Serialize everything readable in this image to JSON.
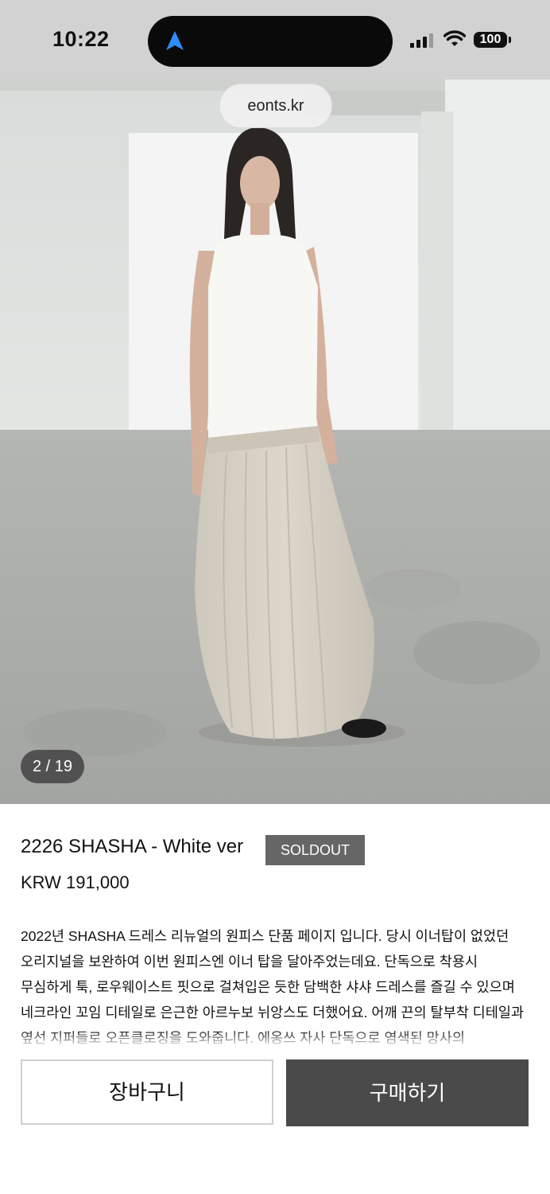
{
  "status_bar": {
    "time": "10:22",
    "battery": "100",
    "icons": [
      "navigation-arrow-icon",
      "signal-icon",
      "wifi-icon",
      "battery-icon"
    ]
  },
  "browser": {
    "url": "eonts.kr"
  },
  "gallery": {
    "counter": "2 / 19"
  },
  "product": {
    "title": "2226 SHASHA - White ver",
    "badge": "SOLDOUT",
    "price": "KRW 191,000",
    "description": "2022년 SHASHA 드레스 리뉴얼의 원피스 단품 페이지 입니다. 당시 이너탑이 없었던 오리지널을 보완하여 이번 원피스엔 이너 탑을 달아주었는데요. 단독으로 착용시 무심하게 툭, 로우웨이스트 핏으로 걸쳐입은 듯한 담백한 샤샤 드레스를 즐길 수 있으며 네크라인 꼬임 디테일로 은근한 아르누보 뉘앙스도 더했어요. 어깨 끈의 탈부착 디테일과 옆선 지퍼들로 오픈클로징을 도와줍니다. 에옹쓰 자사 단독으로 염색된 망사의 드레이프으로 오묘한 색감을 즐기시네요."
  },
  "actions": {
    "cart_label": "장바구니",
    "buy_label": "구매하기"
  },
  "colors": {
    "status_bar_bg": "#d2d2d2",
    "badge_bg": "#666666",
    "buy_bg": "#4a4a4a",
    "nav_arrow": "#2d8cff"
  }
}
